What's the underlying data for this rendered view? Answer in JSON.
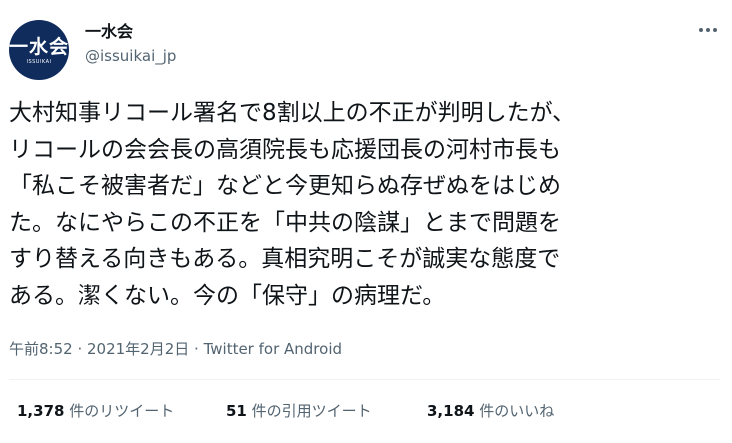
{
  "account": {
    "avatar_text": "一水会",
    "avatar_subtext": "ISSUIKAI",
    "display_name": "一水会",
    "handle": "@issuikai_jp"
  },
  "tweet": {
    "text": "大村知事リコール署名で8割以上の不正が判明したが、\nリコールの会会長の高須院長も応援団長の河村市長も\n「私こそ被害者だ」などと今更知らぬ存ぜぬをはじめ\nた。なにやらこの不正を「中共の陰謀」とまで問題を\nすり替える向きもある。真相究明こそが誠実な態度で\nある。潔くない。今の「保守」の病理だ。",
    "time": "午前8:52",
    "separator1": " · ",
    "date": "2021年2月2日",
    "separator2": " · ",
    "source": "Twitter for Android"
  },
  "stats": {
    "retweets_count": "1,378",
    "retweets_label": " 件のリツイート",
    "quotes_count": "51",
    "quotes_label": " 件の引用ツイート",
    "likes_count": "3,184",
    "likes_label": " 件のいいね"
  },
  "icons": {
    "more": "more-horizontal-icon"
  },
  "colors": {
    "text": "#0f1419",
    "secondary": "#536471",
    "divider": "#eff3f4",
    "avatar_bg": "#0f2c5c"
  }
}
